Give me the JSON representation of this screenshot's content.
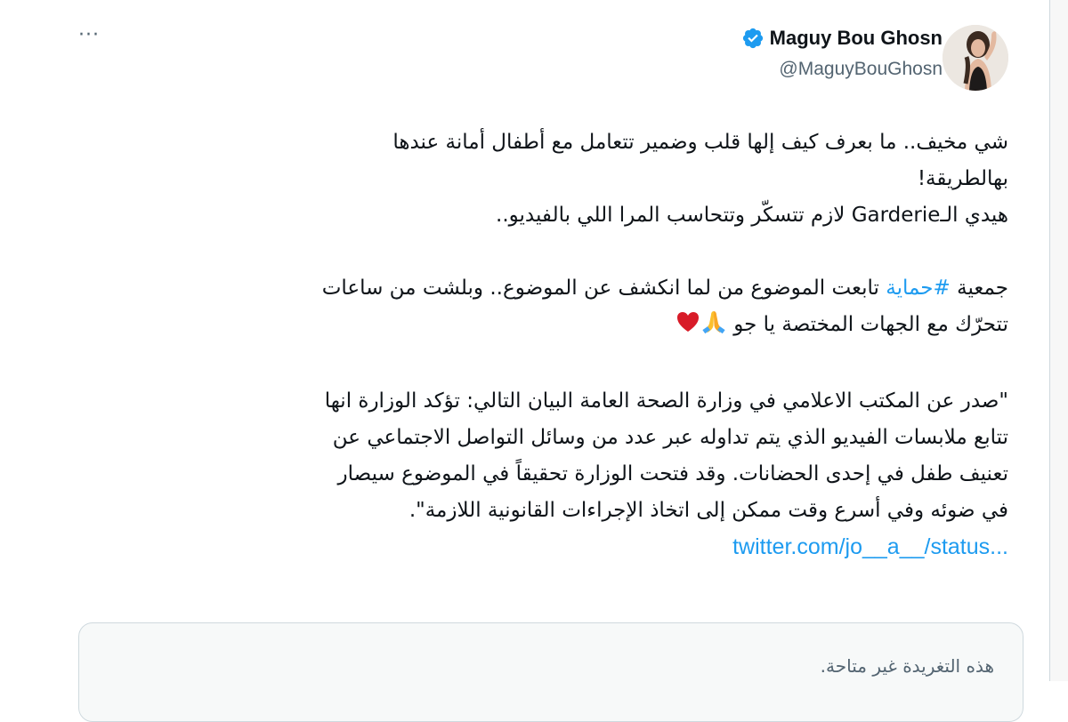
{
  "tweet": {
    "author_name": "Maguy Bou Ghosn",
    "author_handle": "@MaguyBouGhosn",
    "more_label": "···",
    "lines": {
      "p1_l1": "شي مخيف.. ما بعرف كيف إلها قلب وضمير تتعامل مع أطفال أمانة عندها",
      "p1_l2": "بهالطريقة!",
      "p1_l3": "هيدي الـGarderie لازم تتسكّر وتتحاسب المرا اللي بالفيديو..",
      "p2_before_hashtag": "جمعية ",
      "p2_hashtag": "#حماية",
      "p2_after_hashtag": " تابعت الموضوع من لما انكشف عن الموضوع.. وبلشت من ساعات",
      "p2_l2": "تتحرّك مع الجهات المختصة يا جو ",
      "p3_l1": "\"صدر عن المكتب الاعلامي في وزارة الصحة العامة البيان التالي: تؤكد الوزارة انها",
      "p3_l2": "تتابع ملابسات الفيديو الذي يتم تداوله عبر عدد من وسائل التواصل الاجتماعي عن",
      "p3_l3": "تعنيف طفل في إحدى الحضانات. وقد فتحت الوزارة تحقيقاً في الموضوع سيصار",
      "p3_l4": "في ضوئه وفي أسرع وقت ممكن إلى اتخاذ الإجراءات القانونية اللازمة\"."
    },
    "link_text": "twitter.com/jo__a__/status...",
    "emojis": [
      "folded-hands-icon",
      "red-heart-icon"
    ],
    "colors": {
      "link": "#1d9bf0",
      "verified": "#1d9bf0",
      "text": "#0f1419",
      "secondary": "#536471"
    }
  },
  "quote": {
    "unavailable_text": "هذه التغريدة غير متاحة."
  }
}
